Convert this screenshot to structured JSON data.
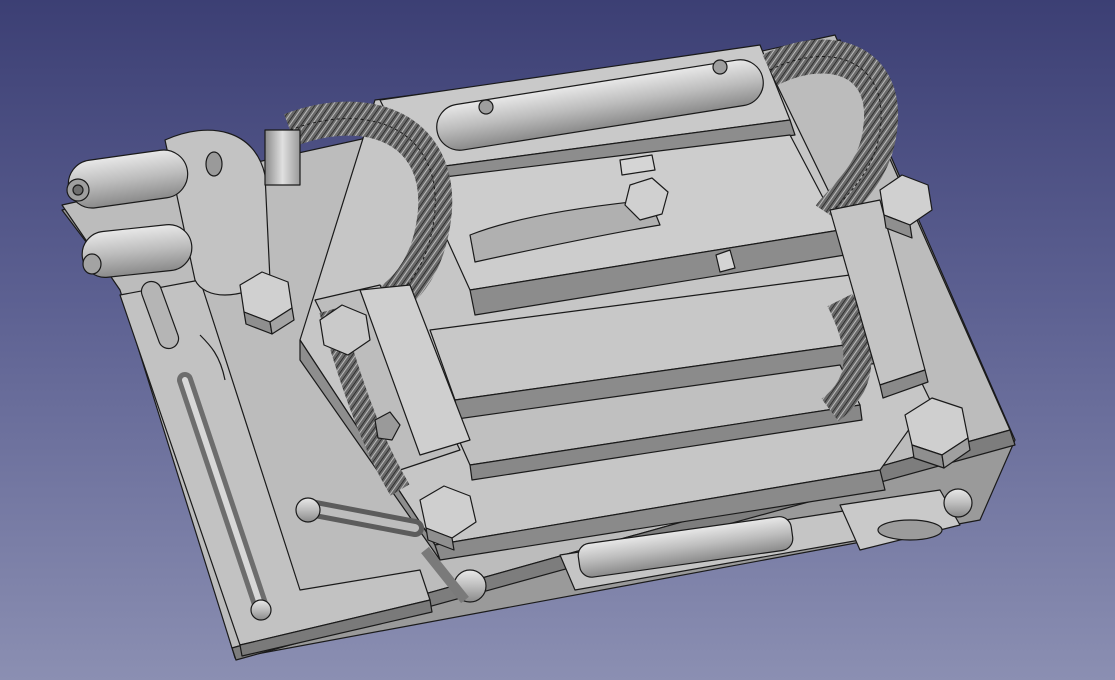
{
  "viewport": {
    "background_top": "#3c3f74",
    "background_bottom": "#8b8fb2"
  },
  "model": {
    "face_color": "#b9b9b9",
    "edge_color": "#1a1a1a",
    "shadow_color": "#8c8c8c"
  }
}
